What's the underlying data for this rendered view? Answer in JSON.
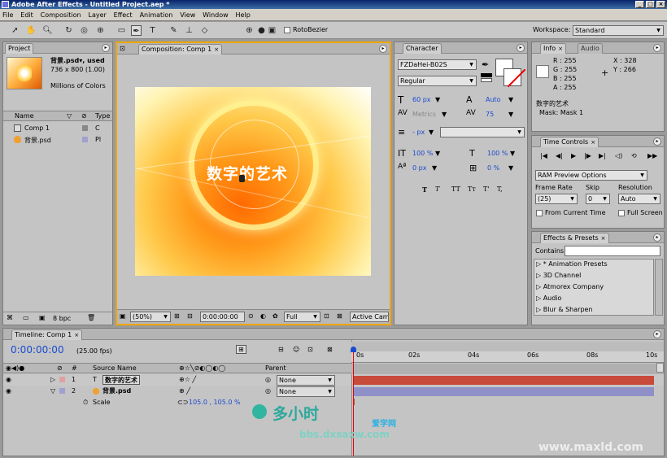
{
  "title": "Adobe After Effects - Untitled Project.aep *",
  "window_buttons": [
    "_",
    "□",
    "×"
  ],
  "menu": [
    "File",
    "Edit",
    "Composition",
    "Layer",
    "Effect",
    "Animation",
    "View",
    "Window",
    "Help"
  ],
  "toolbar": {
    "rotobezier_label": "RotoBezier",
    "workspace_label": "Workspace:",
    "workspace_value": "Standard"
  },
  "project": {
    "tab": "Project",
    "item_name": "背景.psd",
    "item_used": "▾, used",
    "item_dims": "736 x 800 (1.00)",
    "item_colors": "Millions of Colors",
    "col_name": "Name",
    "col_type": "Type",
    "rows": [
      {
        "name": "Comp 1",
        "type": "C"
      },
      {
        "name": "背景.psd",
        "type": "Pl"
      }
    ],
    "bpc": "8 bpc"
  },
  "composition": {
    "tab": "Composition: Comp 1",
    "overlay_text": "数字的艺术",
    "zoom": "(50%)",
    "timecode": "0:00:00:00",
    "resolution": "Full",
    "camera": "Active Came"
  },
  "character": {
    "tab": "Character",
    "font": "FZDaHei-B02S",
    "style": "Regular",
    "size": "60 px",
    "leading": "Auto",
    "kerning": "Metrics",
    "tracking": "75",
    "stroke_width": "- px",
    "vscale": "100 %",
    "hscale": "100 %",
    "baseline": "0 px",
    "tsume": "0 %",
    "styles": [
      "T",
      "T",
      "TT",
      "Tт",
      "T'",
      "T,"
    ]
  },
  "info": {
    "tab": "Info",
    "tab2": "Audio",
    "r": "R : 255",
    "g": "G : 255",
    "b": "B : 255",
    "a": "A : 255",
    "x": "X : 328",
    "y": "Y : 266",
    "layer": "数字的艺术",
    "mask": "Mask: Mask 1"
  },
  "time_controls": {
    "tab": "Time Controls",
    "ram_preview": "RAM Preview Options",
    "frame_rate_label": "Frame Rate",
    "skip_label": "Skip",
    "resolution_label": "Resolution",
    "frame_rate": "(25)",
    "skip": "0",
    "resolution": "Auto",
    "from_current": "From Current Time",
    "full_screen": "Full Screen"
  },
  "effects": {
    "tab": "Effects & Presets",
    "contains_label": "Contains:",
    "items": [
      "* Animation Presets",
      "3D Channel",
      "Atmorex Company",
      "Audio",
      "Blur & Sharpen"
    ]
  },
  "timeline": {
    "tab": "Timeline: Comp 1",
    "timecode": "0:00:00:00",
    "fps": "(25.00 fps)",
    "col_num": "#",
    "col_source": "Source Name",
    "col_parent": "Parent",
    "ruler": [
      "0s",
      "02s",
      "04s",
      "06s",
      "08s",
      "10s"
    ],
    "layers": [
      {
        "num": "1",
        "type": "T",
        "name": "数字的艺术",
        "parent": "None"
      },
      {
        "num": "2",
        "type": "img",
        "name": "背景.psd",
        "parent": "None"
      }
    ],
    "scale_label": "Scale",
    "scale_value": "105.0 , 105.0 %"
  },
  "watermarks": {
    "logo": "多小时",
    "logo_sub": "爱学网",
    "bbs": "bbs.dxsaxw.com",
    "maxld": "www.maxld.com"
  },
  "colors": {
    "accent": "#f0a500",
    "blue": "#1a4bd1",
    "layer1_bar": "#c84a3a",
    "layer2_bar": "#9090c8"
  }
}
